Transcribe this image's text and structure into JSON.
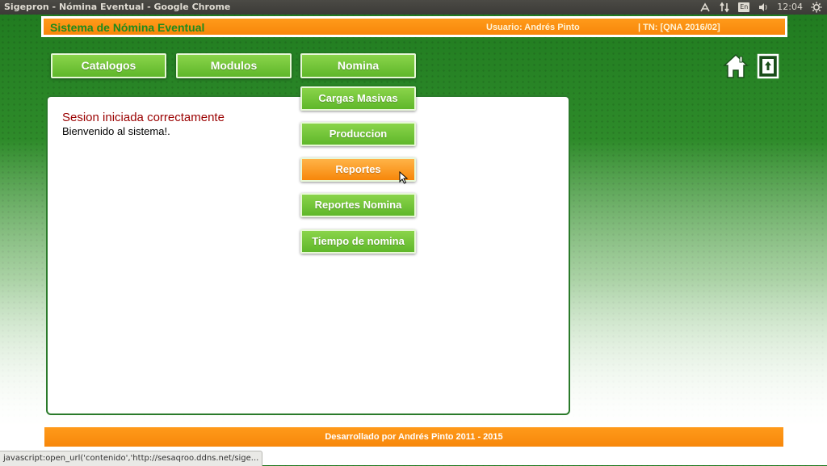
{
  "os": {
    "window_title": "Sigepron - Nómina Eventual - Google Chrome",
    "keyboard_layout": "En",
    "clock": "12:04"
  },
  "header": {
    "title": "Sistema de Nómina Eventual",
    "user": "Usuario: Andrés Pinto",
    "tn": "| TN: [QNA 2016/02]"
  },
  "nav": {
    "catalogos": "Catalogos",
    "modulos": "Modulos",
    "nomina": "Nomina"
  },
  "submenu": {
    "items": [
      {
        "label": "Cargas Masivas"
      },
      {
        "label": "Produccion"
      },
      {
        "label": "Reportes"
      },
      {
        "label": "Reportes Nomina"
      },
      {
        "label": "Tiempo de nomina"
      }
    ],
    "hovered_index": 2
  },
  "panel": {
    "title": "Sesion iniciada correctamente",
    "body": "Bienvenido al sistema!."
  },
  "footer": {
    "text": "Desarrollado por Andrés Pinto 2011 - 2015"
  },
  "statusbar": {
    "text": "javascript:open_url('contenido','http://sesaqroo.ddns.net/sige..."
  },
  "icons": {
    "home": "home-icon",
    "exit": "exit-icon"
  },
  "colors": {
    "accent_orange": "#f7870a",
    "button_green": "#5fb72a",
    "title_green": "#1e8a1e",
    "message_red": "#9a0000"
  }
}
